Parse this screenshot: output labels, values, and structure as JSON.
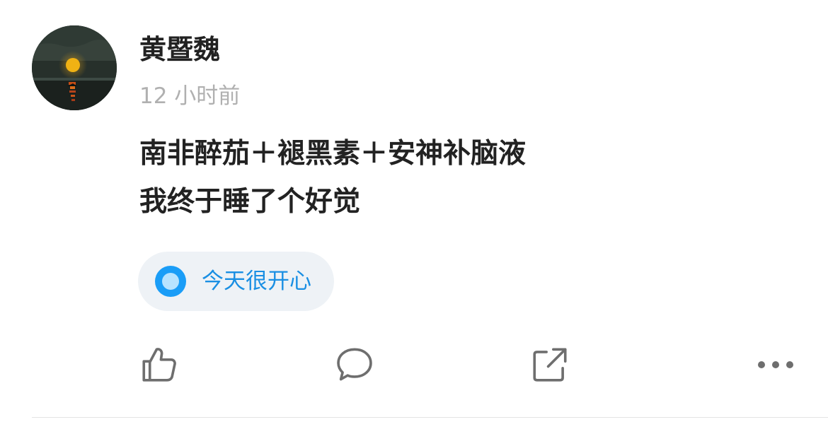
{
  "user": {
    "name": "黄暨魏",
    "time": "12 小时前",
    "avatar_icon": "moonrise-avatar"
  },
  "post": {
    "lines": [
      "南非醉茄＋褪黑素＋安神补脑液",
      "我终于睡了个好觉"
    ]
  },
  "topic": {
    "label": "今天很开心",
    "icon": "topic-dot-icon",
    "color": "#1a8fe3"
  },
  "actions": [
    {
      "icon": "thumbs-up-icon"
    },
    {
      "icon": "comment-icon"
    },
    {
      "icon": "share-icon"
    },
    {
      "icon": "more-icon"
    }
  ]
}
